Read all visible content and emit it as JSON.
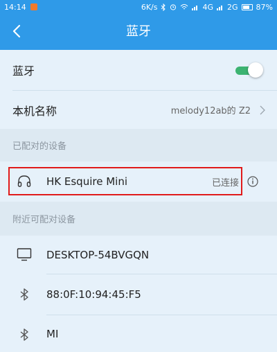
{
  "status_bar": {
    "time": "14:14",
    "speed": "6K/s",
    "network_4g": "4G",
    "network_2g": "2G",
    "battery": "87%"
  },
  "app_bar": {
    "title": "蓝牙"
  },
  "bluetooth_row": {
    "label": "蓝牙",
    "enabled": true
  },
  "device_name_row": {
    "label": "本机名称",
    "value": "melody12ab的 Z2"
  },
  "paired_section": {
    "header": "已配对的设备",
    "devices": [
      {
        "name": "HK Esquire Mini",
        "status": "已连接",
        "icon": "headphones-icon"
      }
    ]
  },
  "nearby_section": {
    "header": "附近可配对设备",
    "devices": [
      {
        "name": "DESKTOP-54BVGQN",
        "icon": "monitor-icon"
      },
      {
        "name": "88:0F:10:94:45:F5",
        "icon": "bluetooth-icon"
      },
      {
        "name": "MI",
        "icon": "bluetooth-icon"
      }
    ]
  },
  "colors": {
    "accent": "#2f9ae8",
    "toggle_on": "#3cb371",
    "highlight": "#e01a1a"
  }
}
